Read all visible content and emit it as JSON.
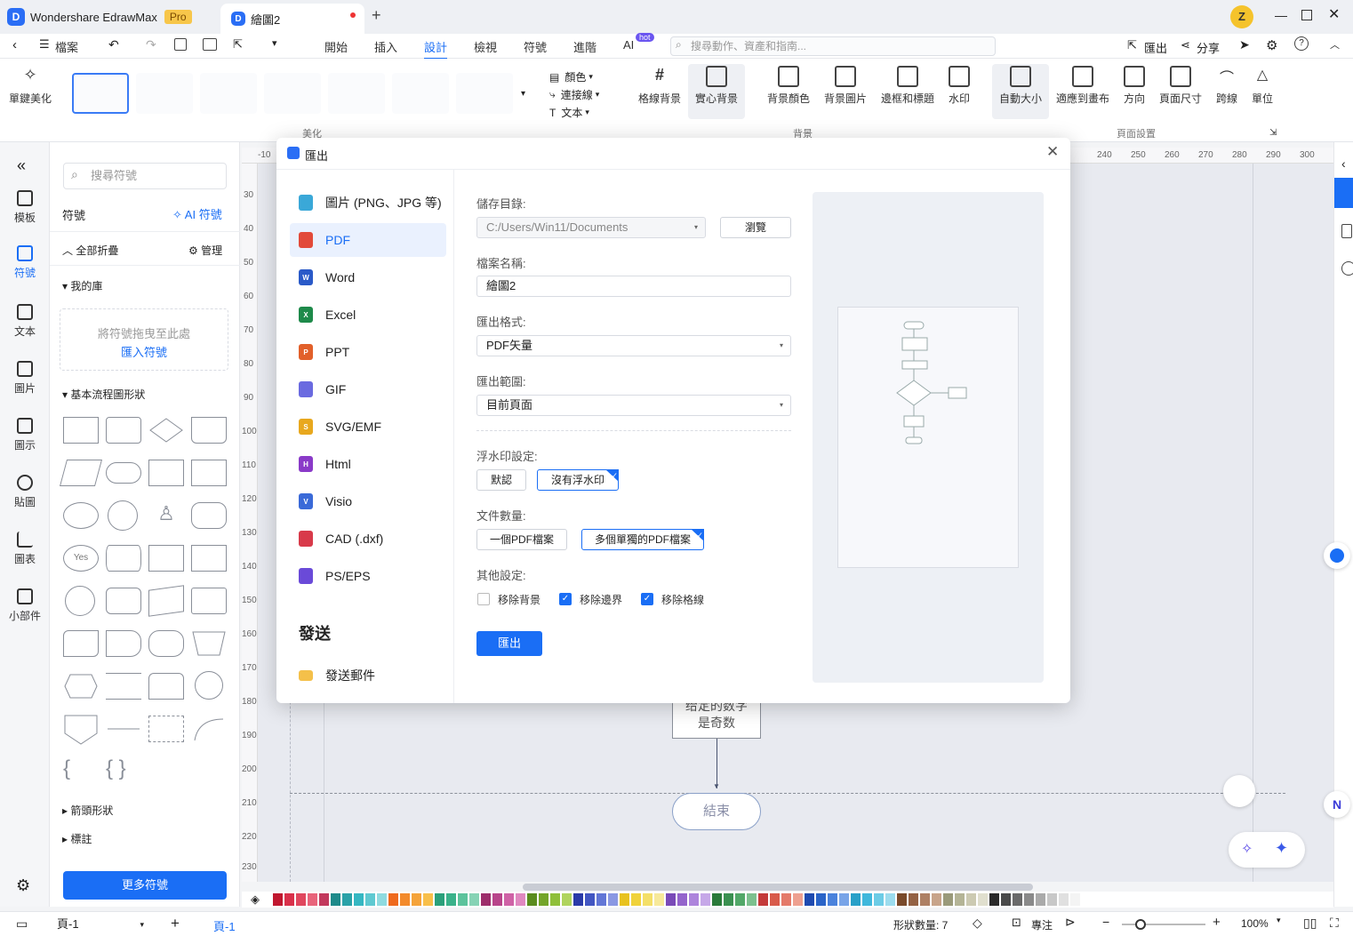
{
  "titlebar": {
    "app_name": "Wondershare EdrawMax",
    "pro_label": "Pro",
    "doc_tab": "繪圖2",
    "new_tab": "+",
    "avatar_letter": "Z"
  },
  "menu": {
    "items": [
      "檔案",
      "開始",
      "插入",
      "設計",
      "檢視",
      "符號",
      "進階",
      "AI"
    ],
    "active": "設計",
    "ai_badge": "hot",
    "search_placeholder": "搜尋動作、資產和指南...",
    "export_label": "匯出",
    "share_label": "分享"
  },
  "ribbon": {
    "one_click_beautify": "單鍵美化",
    "beautify_group": "美化",
    "color_label": "顏色",
    "connector_label": "連接線",
    "text_label": "文本",
    "grid_bg": "格線背景",
    "solid_bg": "實心背景",
    "bg_color": "背景顏色",
    "bg_image": "背景圖片",
    "border_title": "邊框和標題",
    "watermark": "水印",
    "background_group": "背景",
    "auto_size": "自動大小",
    "fit_to_canvas": "適應到畫布",
    "orientation": "方向",
    "page_size": "頁面尺寸",
    "jump_line": "跨線",
    "unit": "單位",
    "page_setup_group": "頁面設置"
  },
  "rail": {
    "items": [
      "模板",
      "符號",
      "文本",
      "圖片",
      "圖示",
      "貼圖",
      "圖表",
      "小部件"
    ],
    "active": "符號"
  },
  "symbol_panel": {
    "search_placeholder": "搜尋符號",
    "title": "符號",
    "ai_symbol": "AI 符號",
    "collapse_all": "全部折疊",
    "manage": "管理",
    "my_library": "我的庫",
    "drop_hint": "將符號拖曳至此處",
    "import_symbol": "匯入符號",
    "basic_flowchart": "基本流程圖形狀",
    "yes_label": "Yes",
    "arrow_shapes": "箭頭形狀",
    "callouts": "標註",
    "more_symbols": "更多符號"
  },
  "canvas": {
    "ruler_top": [
      "-10",
      "240",
      "250",
      "260",
      "270",
      "280",
      "290",
      "300"
    ],
    "ruler_left": [
      "30",
      "40",
      "50",
      "60",
      "70",
      "80",
      "90",
      "100",
      "110",
      "120",
      "130",
      "140",
      "150",
      "160",
      "170",
      "180",
      "190",
      "200",
      "210",
      "220",
      "230"
    ],
    "process_text_line1": "给定的数字",
    "process_text_line2": "是奇数",
    "end_text": "結束"
  },
  "dialog": {
    "title": "匯出",
    "formats": [
      "圖片 (PNG、JPG 等)",
      "PDF",
      "Word",
      "Excel",
      "PPT",
      "GIF",
      "SVG/EMF",
      "Html",
      "Visio",
      "CAD (.dxf)",
      "PS/EPS"
    ],
    "selected_format": "PDF",
    "send_heading": "發送",
    "send_email": "發送郵件",
    "save_dir_label": "儲存目錄:",
    "save_dir_value": "C:/Users/Win11/Documents",
    "browse": "瀏覽",
    "filename_label": "檔案名稱:",
    "filename_value": "繪圖2",
    "format_label": "匯出格式:",
    "format_value": "PDF矢量",
    "range_label": "匯出範圍:",
    "range_value": "目前頁面",
    "watermark_label": "浮水印設定:",
    "watermark_default": "默認",
    "watermark_none": "沒有浮水印",
    "doc_count_label": "文件數量:",
    "doc_single": "一個PDF檔案",
    "doc_multi": "多個單獨的PDF檔案",
    "other_label": "其他設定:",
    "opt_remove_bg": "移除背景",
    "opt_remove_border": "移除邊界",
    "opt_remove_grid": "移除格線",
    "opt_remove_bg_checked": false,
    "opt_remove_border_checked": true,
    "opt_remove_grid_checked": true,
    "export_button": "匯出"
  },
  "status": {
    "page_select": "頁-1",
    "add_page": "+",
    "active_page": "頁-1",
    "shape_count": "形狀數量: 7",
    "focus": "專注",
    "zoom": "100%"
  },
  "colors": {
    "accent": "#1a6ef5",
    "palette": [
      "#c0172f",
      "#d9304a",
      "#e0475e",
      "#e8637a",
      "#c2385c",
      "#1e8a8a",
      "#2aa2a8",
      "#35b7c2",
      "#5fc9d1",
      "#8fdbe0",
      "#ef6a1e",
      "#f38a2b",
      "#f5a33a",
      "#f8bf4a",
      "#2aa07a",
      "#3ab28a",
      "#5cc39c",
      "#86d3b5",
      "#9d2d6b",
      "#b8448a",
      "#cf62a6",
      "#e088c0",
      "#5a8c1e",
      "#73a52a",
      "#8fbf3a",
      "#b0d45e",
      "#2a3aa8",
      "#4256c2",
      "#6276d6",
      "#8a98e3",
      "#e8c21e",
      "#f0d23a",
      "#f4df68",
      "#f7e99a",
      "#7a4ab8",
      "#9464cc",
      "#ad84dc",
      "#c6a8e8",
      "#2a7a3a",
      "#3a9050",
      "#52a868",
      "#7cc08e",
      "#c43a3a",
      "#d85a4a",
      "#e47a6a",
      "#eea090",
      "#1e4ab0",
      "#2a64c8",
      "#4a82dc",
      "#78a4e8",
      "#28a0c8",
      "#40b8dc",
      "#6ccce6",
      "#9cdcee",
      "#7a4a2a",
      "#946244",
      "#ae8064",
      "#c8a48a",
      "#9a9a7a",
      "#b4b496",
      "#cccab2",
      "#e0dfce",
      "#2a2a2a",
      "#4a4a4a",
      "#6a6a6a",
      "#8a8a8a",
      "#aaaaaa",
      "#c8c8c8",
      "#e0e0e0",
      "#f4f4f4"
    ]
  }
}
